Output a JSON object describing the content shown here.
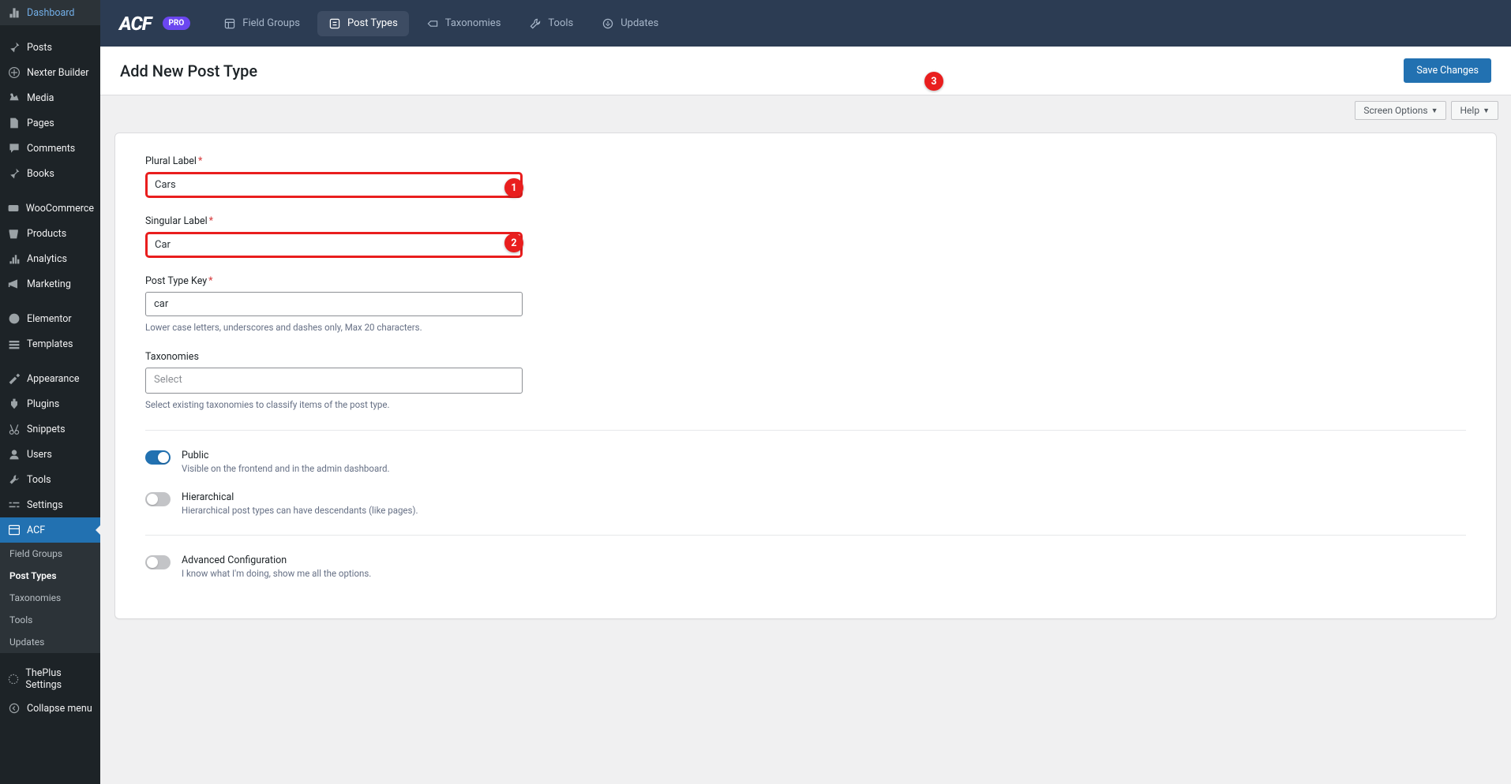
{
  "sidebar": {
    "items": [
      {
        "icon": "dashboard",
        "label": "Dashboard"
      },
      {
        "icon": "pin",
        "label": "Posts"
      },
      {
        "icon": "nexter",
        "label": "Nexter Builder"
      },
      {
        "icon": "media",
        "label": "Media"
      },
      {
        "icon": "page",
        "label": "Pages"
      },
      {
        "icon": "comment",
        "label": "Comments"
      },
      {
        "icon": "pin",
        "label": "Books"
      },
      {
        "icon": "woo",
        "label": "WooCommerce"
      },
      {
        "icon": "product",
        "label": "Products"
      },
      {
        "icon": "analytics",
        "label": "Analytics"
      },
      {
        "icon": "marketing",
        "label": "Marketing"
      },
      {
        "icon": "elementor",
        "label": "Elementor"
      },
      {
        "icon": "templates",
        "label": "Templates"
      },
      {
        "icon": "appearance",
        "label": "Appearance"
      },
      {
        "icon": "plugins",
        "label": "Plugins"
      },
      {
        "icon": "snippets",
        "label": "Snippets"
      },
      {
        "icon": "users",
        "label": "Users"
      },
      {
        "icon": "tools",
        "label": "Tools"
      },
      {
        "icon": "settings",
        "label": "Settings"
      },
      {
        "icon": "acf",
        "label": "ACF"
      },
      {
        "icon": "theplus",
        "label": "ThePlus Settings"
      },
      {
        "icon": "collapse",
        "label": "Collapse menu"
      }
    ],
    "sub": [
      {
        "label": "Field Groups"
      },
      {
        "label": "Post Types"
      },
      {
        "label": "Taxonomies"
      },
      {
        "label": "Tools"
      },
      {
        "label": "Updates"
      }
    ]
  },
  "acfbar": {
    "logo": "ACF",
    "pro": "PRO",
    "tabs": [
      {
        "label": "Field Groups"
      },
      {
        "label": "Post Types"
      },
      {
        "label": "Taxonomies"
      },
      {
        "label": "Tools"
      },
      {
        "label": "Updates"
      }
    ]
  },
  "header": {
    "title": "Add New Post Type",
    "save": "Save Changes"
  },
  "util": {
    "screen": "Screen Options",
    "help": "Help"
  },
  "form": {
    "plural_label": "Plural Label",
    "plural_value": "Cars",
    "singular_label": "Singular Label",
    "singular_value": "Car",
    "key_label": "Post Type Key",
    "key_value": "car",
    "key_help": "Lower case letters, underscores and dashes only, Max 20 characters.",
    "tax_label": "Taxonomies",
    "tax_placeholder": "Select",
    "tax_help": "Select existing taxonomies to classify items of the post type.",
    "public_label": "Public",
    "public_desc": "Visible on the frontend and in the admin dashboard.",
    "hier_label": "Hierarchical",
    "hier_desc": "Hierarchical post types can have descendants (like pages).",
    "adv_label": "Advanced Configuration",
    "adv_desc": "I know what I'm doing, show me all the options."
  },
  "badges": {
    "b1": "1",
    "b2": "2",
    "b3": "3"
  }
}
